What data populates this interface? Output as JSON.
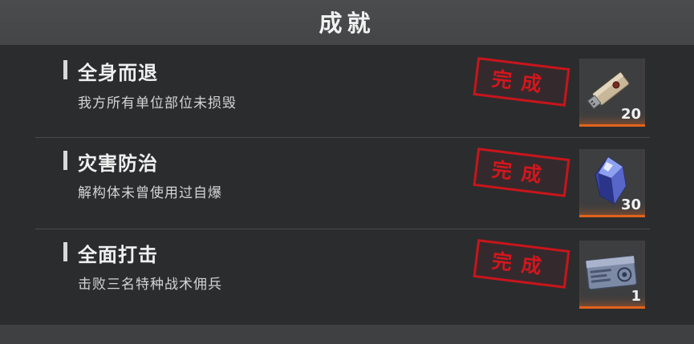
{
  "header": {
    "title": "成就"
  },
  "achievements": [
    {
      "title": "全身而退",
      "description": "我方所有单位部位未损毁",
      "status": "完成",
      "reward": {
        "icon": "usb-key-icon",
        "count": "20"
      }
    },
    {
      "title": "灾害防治",
      "description": "解构体未曾使用过自爆",
      "status": "完成",
      "reward": {
        "icon": "blue-crystal-icon",
        "count": "30"
      }
    },
    {
      "title": "全面打击",
      "description": "击败三名特种战术佣兵",
      "status": "完成",
      "reward": {
        "icon": "ticket-card-icon",
        "count": "1"
      }
    }
  ],
  "colors": {
    "stamp_red": "#c8151b",
    "reward_accent": "#e0641c"
  }
}
